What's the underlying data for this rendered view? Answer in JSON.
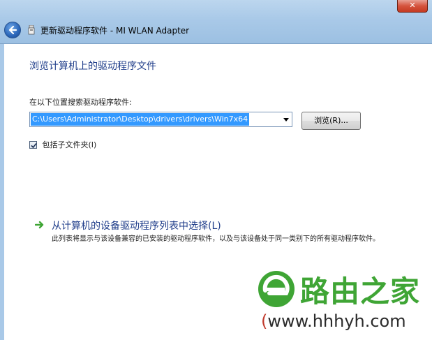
{
  "window": {
    "title": "更新驱动程序软件 - MI WLAN Adapter",
    "close_label": "✕"
  },
  "content": {
    "heading": "浏览计算机上的驱动程序文件",
    "search_label": "在以下位置搜索驱动程序软件:",
    "path_value": "C:\\Users\\Administrator\\Desktop\\drivers\\drivers\\Win7x64",
    "browse_label": "浏览(R)...",
    "include_subfolders_label": "包括子文件夹(I)",
    "include_subfolders_checked": true,
    "pick_title": "从计算机的设备驱动程序列表中选择(L)",
    "pick_description": "此列表将显示与该设备兼容的已安装的驱动程序软件，以及与该设备处于同一类别下的所有驱动程序软件。"
  },
  "watermark": {
    "brand": "路由之家",
    "url_open": "(",
    "url": "www.hhhyh.com"
  },
  "colors": {
    "heading": "#1f3d8a",
    "selection": "#3399ff",
    "glass": "#a9c9e8",
    "close": "#c43a22",
    "arrow": "#3fa535"
  }
}
